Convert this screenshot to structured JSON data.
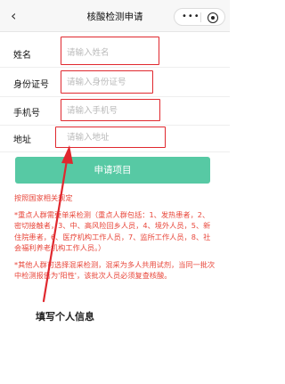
{
  "navbar": {
    "back_icon": "‹",
    "title": "核酸检测申请",
    "more_icon": "•••"
  },
  "form": {
    "fields": [
      {
        "label": "姓名",
        "placeholder": "请输入姓名"
      },
      {
        "label": "身份证号",
        "placeholder": "请输入身份证号"
      },
      {
        "label": "手机号",
        "placeholder": "请输入手机号"
      },
      {
        "label": "地址",
        "placeholder": "请输入地址"
      }
    ],
    "submit_label": "申请项目"
  },
  "notes": {
    "heading": "按照国家相关规定",
    "note1": "*重点人群需要单采检测（重点人群包括：1、发热患者，2、密切接触者，3、中、高风险回乡人员，4、境外人员，5、新住院患者，6、医疗机构工作人员，7、监所工作人员，8、社会福利养老机构工作人员。）",
    "note2": "*其他人群可选择混采检测，混采为多人共用试剂，当同一批次中检测报告为'阳性'，该批次人员必须复查核酸。"
  },
  "annotation": {
    "text": "填写个人信息",
    "color": "#e0282e"
  },
  "colors": {
    "accent": "#57c9a4",
    "notice": "#e8473b"
  }
}
